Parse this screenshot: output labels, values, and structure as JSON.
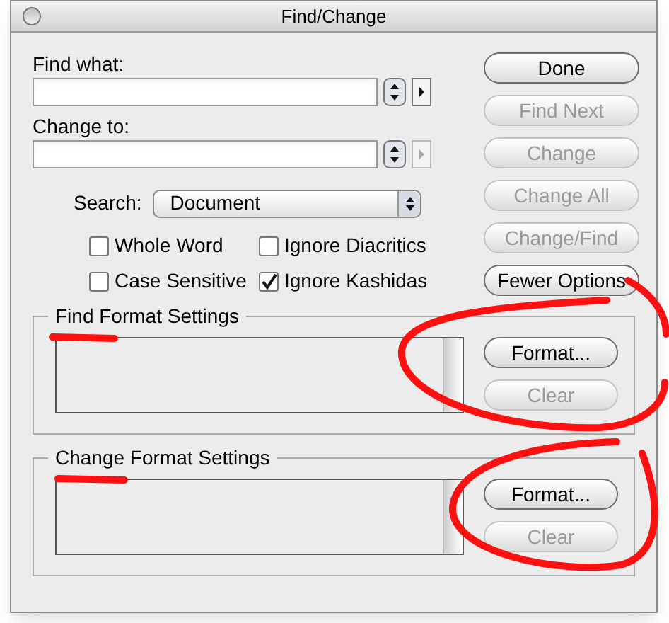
{
  "window": {
    "title": "Find/Change"
  },
  "fields": [
    {
      "label": "Find what:",
      "arrow_disabled": false
    },
    {
      "label": "Change to:",
      "arrow_disabled": true
    }
  ],
  "search": {
    "label": "Search:",
    "value": "Document"
  },
  "options": [
    {
      "label": "Whole Word",
      "checked": false
    },
    {
      "label": "Ignore Diacritics",
      "checked": false
    },
    {
      "label": "Case Sensitive",
      "checked": false
    },
    {
      "label": "Ignore Kashidas",
      "checked": true
    }
  ],
  "buttons": [
    {
      "label": "Done",
      "disabled": false
    },
    {
      "label": "Find Next",
      "disabled": true
    },
    {
      "label": "Change",
      "disabled": true
    },
    {
      "label": "Change All",
      "disabled": true
    },
    {
      "label": "Change/Find",
      "disabled": true
    },
    {
      "label": "Fewer Options",
      "disabled": false
    }
  ],
  "format_groups": [
    {
      "title": "Find Format Settings",
      "buttons": [
        {
          "label": "Format...",
          "disabled": false
        },
        {
          "label": "Clear",
          "disabled": true
        }
      ]
    },
    {
      "title": "Change Format Settings",
      "buttons": [
        {
          "label": "Format...",
          "disabled": false
        },
        {
          "label": "Clear",
          "disabled": true
        }
      ]
    }
  ]
}
